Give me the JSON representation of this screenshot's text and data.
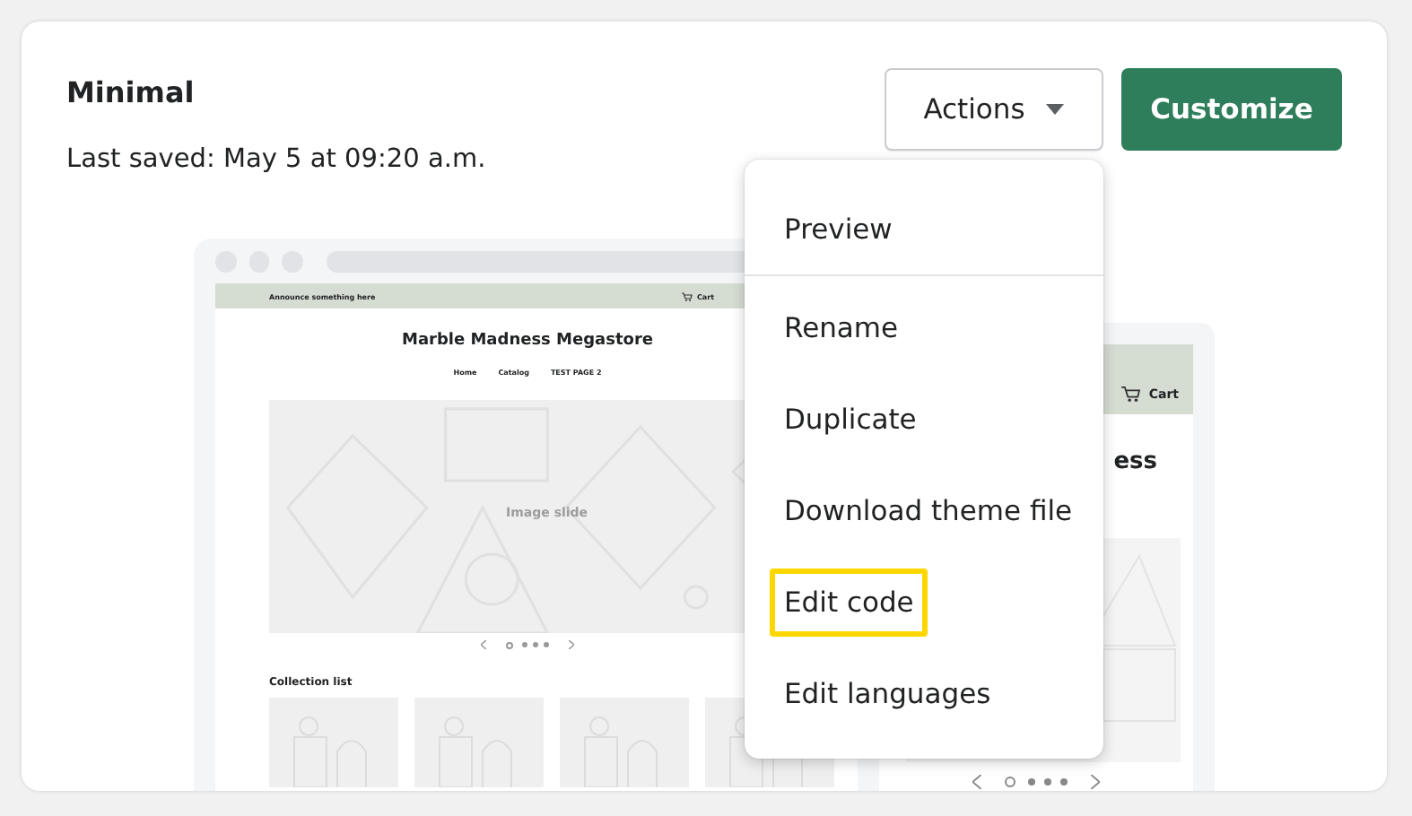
{
  "theme": {
    "name": "Minimal",
    "last_saved": "Last saved: May 5 at 09:20 a.m."
  },
  "actions_button": {
    "label": "Actions"
  },
  "customize_button": {
    "label": "Customize"
  },
  "menu": {
    "items": [
      {
        "label": "Preview",
        "highlighted": false,
        "divider_after": true
      },
      {
        "label": "Rename",
        "highlighted": false,
        "divider_after": false
      },
      {
        "label": "Duplicate",
        "highlighted": false,
        "divider_after": false
      },
      {
        "label": "Download theme file",
        "highlighted": false,
        "divider_after": false
      },
      {
        "label": "Edit code",
        "highlighted": true,
        "divider_after": false
      },
      {
        "label": "Edit languages",
        "highlighted": false,
        "divider_after": false
      }
    ]
  },
  "desktop_preview": {
    "announcement": "Announce something here",
    "cart": "Cart",
    "store_name": "Marble Madness Megastore",
    "nav": [
      "Home",
      "Catalog",
      "TEST PAGE 2"
    ],
    "slide_label": "Image slide",
    "slide_dots": [
      {
        "selected": true
      },
      {
        "selected": false
      },
      {
        "selected": false
      },
      {
        "selected": false
      }
    ],
    "collection_title": "Collection list"
  },
  "mobile_preview": {
    "cart": "Cart",
    "title_fragment": "ess",
    "slide_dots": [
      {
        "selected": true
      },
      {
        "selected": false
      },
      {
        "selected": false
      },
      {
        "selected": false
      }
    ]
  }
}
